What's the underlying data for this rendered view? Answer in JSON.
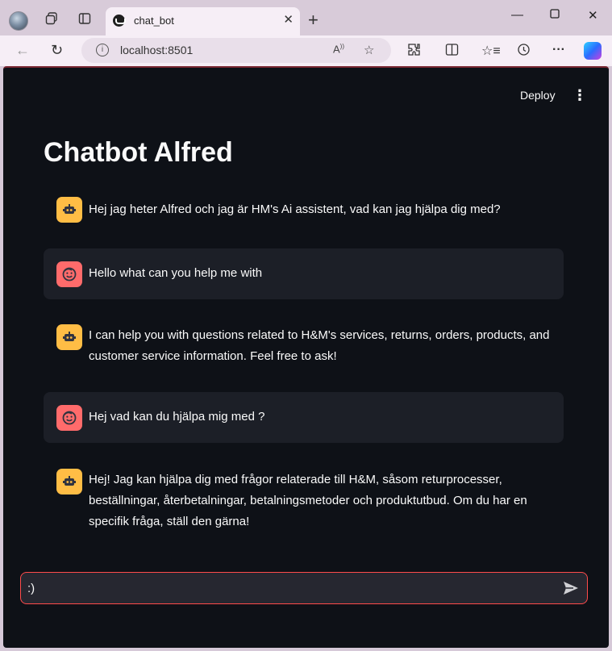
{
  "browser": {
    "tab_title": "chat_bot",
    "url": "localhost:8501"
  },
  "header": {
    "deploy_label": "Deploy"
  },
  "page": {
    "title": "Chatbot Alfred"
  },
  "messages": [
    {
      "role": "assistant",
      "text": "Hej jag heter Alfred och jag är HM's Ai assistent, vad kan jag hjälpa dig med?"
    },
    {
      "role": "user",
      "text": "Hello what can you help me with"
    },
    {
      "role": "assistant",
      "text": "I can help you with questions related to H&M's services, returns, orders, products, and customer service information. Feel free to ask!"
    },
    {
      "role": "user",
      "text": "Hej vad kan du hjälpa mig med ?"
    },
    {
      "role": "assistant",
      "text": "Hej! Jag kan hjälpa dig med frågor relaterade till H&M, såsom returprocesser, beställningar, återbetalningar, betalningsmetoder och produktutbud. Om du har en specifik fråga, ställ den gärna!"
    }
  ],
  "chat_input": {
    "value": ":)"
  },
  "colors": {
    "app_background": "#0e1117",
    "user_message_background": "#1c1f27",
    "assistant_avatar": "#ffbd45",
    "user_avatar": "#ff6b6b",
    "input_border": "#ff4b4b"
  },
  "icons": {
    "assistant_avatar": "robot-icon",
    "user_avatar": "smiley-face-icon",
    "send": "send-arrow-icon",
    "menu": "kebab-menu-icon"
  }
}
